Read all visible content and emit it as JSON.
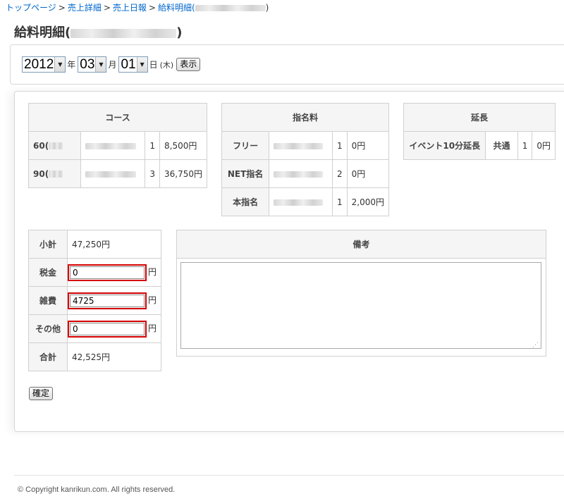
{
  "breadcrumb": {
    "items": [
      "トップページ",
      "売上詳細",
      "売上日報",
      "給料明細("
    ],
    "separator": ">",
    "tail": ")"
  },
  "page": {
    "title_prefix": "給料明細(",
    "title_suffix": ")"
  },
  "date_picker": {
    "year": "2012",
    "year_unit": "年",
    "month": "03",
    "month_unit": "月",
    "day": "01",
    "day_unit": "日",
    "day_of_week": "(木)",
    "show_button": "表示"
  },
  "course_table": {
    "header": "コース",
    "rows": [
      {
        "name": "60(",
        "qty": "1",
        "amount": "8,500円"
      },
      {
        "name": "90(",
        "qty": "3",
        "amount": "36,750円"
      }
    ]
  },
  "nomination_table": {
    "header": "指名料",
    "rows": [
      {
        "label": "フリー",
        "qty": "1",
        "amount": "0円"
      },
      {
        "label": "NET指名",
        "qty": "2",
        "amount": "0円"
      },
      {
        "label": "本指名",
        "qty": "1",
        "amount": "2,000円"
      }
    ]
  },
  "extension_table": {
    "header": "延長",
    "rows": [
      {
        "label": "イベント10分延長",
        "type": "共通",
        "qty": "1",
        "amount": "0円"
      }
    ]
  },
  "summary_table": {
    "subtotal_label": "小計",
    "subtotal_value": "47,250円",
    "tax_label": "税金",
    "tax_value": "0",
    "misc_label": "雑費",
    "misc_value": "4725",
    "other_label": "その他",
    "other_value": "0",
    "yen": "円",
    "total_label": "合計",
    "total_value": "42,525円"
  },
  "remarks": {
    "header": "備考",
    "value": ""
  },
  "confirm_button": "確定",
  "footer": {
    "copyright": "© Copyright kanrikun.com. All rights reserved."
  },
  "colors": {
    "link": "#0066cc",
    "highlight_border": "#d40000",
    "table_header_bg": "#f5f5f5"
  }
}
